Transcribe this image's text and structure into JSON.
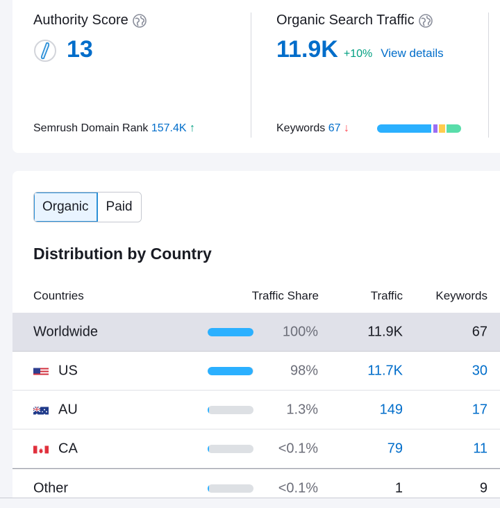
{
  "authority": {
    "title": "Authority Score",
    "value": "13",
    "rank_label": "Semrush Domain Rank",
    "rank_value": "157.4K",
    "rank_trend": "↑"
  },
  "organic": {
    "title": "Organic Search Traffic",
    "value": "11.9K",
    "change": "+10%",
    "details_link": "View details",
    "keywords_label": "Keywords",
    "keywords_value": "67",
    "keywords_trend": "↓"
  },
  "toggle": {
    "organic": "Organic",
    "paid": "Paid"
  },
  "section_title": "Distribution by Country",
  "table": {
    "headers": {
      "countries": "Countries",
      "share": "Traffic Share",
      "traffic": "Traffic",
      "keywords": "Keywords"
    },
    "rows": [
      {
        "country": "Worldwide",
        "share": "100%",
        "share_fraction": 1.0,
        "traffic": "11.9K",
        "keywords": "67"
      },
      {
        "country": "US",
        "flag": "us-flag-icon",
        "share": "98%",
        "share_fraction": 0.98,
        "traffic": "11.7K",
        "keywords": "30"
      },
      {
        "country": "AU",
        "flag": "au-flag-icon",
        "share": "1.3%",
        "share_fraction": 0.013,
        "traffic": "149",
        "keywords": "17"
      },
      {
        "country": "CA",
        "flag": "ca-flag-icon",
        "share": "<0.1%",
        "share_fraction": 0.001,
        "traffic": "79",
        "keywords": "11"
      },
      {
        "country": "Other",
        "share": "<0.1%",
        "share_fraction": 0.001,
        "traffic": "1",
        "keywords": "9"
      }
    ]
  },
  "colors": {
    "brand_blue": "#006dca",
    "bar_blue": "#2bb0ff",
    "positive_green": "#009f81",
    "negative_red": "#ff4953"
  }
}
